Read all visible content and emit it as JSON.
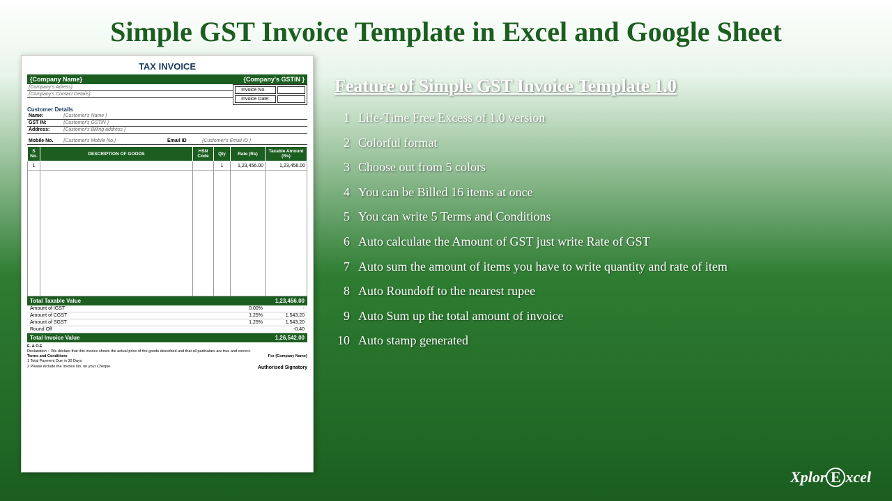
{
  "title": "Simple GST Invoice Template in Excel and Google Sheet",
  "features_heading": "Feature of Simple GST Invoice Template 1.0",
  "features": [
    {
      "num": "1",
      "text": "Life-Time Free Excess of 1.0 version"
    },
    {
      "num": "2",
      "text": "Colorful format"
    },
    {
      "num": "3",
      "text": "Choose out from 5 colors"
    },
    {
      "num": "4",
      "text": "You can be Billed 16 items at once"
    },
    {
      "num": "5",
      "text": "You can write 5 Terms and Conditions"
    },
    {
      "num": "6",
      "text": "Auto calculate the Amount of GST just write Rate of GST"
    },
    {
      "num": "7",
      "text": "Auto sum the amount of items you have to write quantity and rate of item"
    },
    {
      "num": "8",
      "text": "Auto Roundoff to the nearest rupee"
    },
    {
      "num": "9",
      "text": "Auto Sum up the total amount of invoice"
    },
    {
      "num": "10",
      "text": "Auto stamp generated"
    }
  ],
  "invoice": {
    "doc_title": "TAX INVOICE",
    "company_name": "{Company Name}",
    "company_gstin": "{Company's GSTIN }",
    "company_address": "{Company's Adress}",
    "company_contact": "{Company's Contact Details}",
    "invoice_no_label": "Invoice No.",
    "invoice_date_label": "Invoice Date:",
    "customer_section": "Customer Details",
    "name_label": "Name:",
    "name_val": "{Customer's Name }",
    "gstin_label": "GST IN:",
    "gstin_val": "{Customer's GSTIN }",
    "address_label": "Address:",
    "address_val": "{Customer's Billing address }",
    "mobile_label": "Mobile No.",
    "mobile_val": "{Customer's Mobile No.}",
    "email_label": "Email ID",
    "email_val": "{Customer's Email ID }",
    "col_sno": "S No.",
    "col_desc": "DESCRIPTION OF GOODS",
    "col_hsn": "HSN Code",
    "col_qty": "Qty",
    "col_rate": "Rate (Rs)",
    "col_amount": "Taxable Amount (Rs)",
    "row1_sno": "1",
    "row1_qty": "1",
    "row1_rate": "1,23,456.00",
    "row1_amount": "1,23,456.00",
    "total_taxable_label": "Total Taxable Value",
    "total_taxable_val": "1,23,456.00",
    "igst_label": "Amount of IGST",
    "igst_pct": "0.00%",
    "igst_val": "-",
    "cgst_label": "Amount of CGST",
    "cgst_pct": "1.25%",
    "cgst_val": "1,543.20",
    "sgst_label": "Amount of SGST",
    "sgst_pct": "1.25%",
    "sgst_val": "1,543.20",
    "roundoff_label": "Round Off",
    "roundoff_val": "-0.40",
    "total_invoice_label": "Total Invoice Value",
    "total_invoice_val": "1,26,542.00",
    "eoe": "E. & O.E",
    "declaration": "Declaration :- We declare that this invoice shows the actual price of the goods described and that all particulars are true and correct.",
    "terms_label": "Terms and Conditions",
    "term1": "1   Total Payment Due in 30 Days",
    "term2": "2   Please include the Invoice No. on your Cheque",
    "for_company": "For {Company Name}",
    "signatory": "Authorised Signatory"
  },
  "logo": {
    "part1": "Xplor",
    "part2": "E",
    "part3": "xcel"
  }
}
